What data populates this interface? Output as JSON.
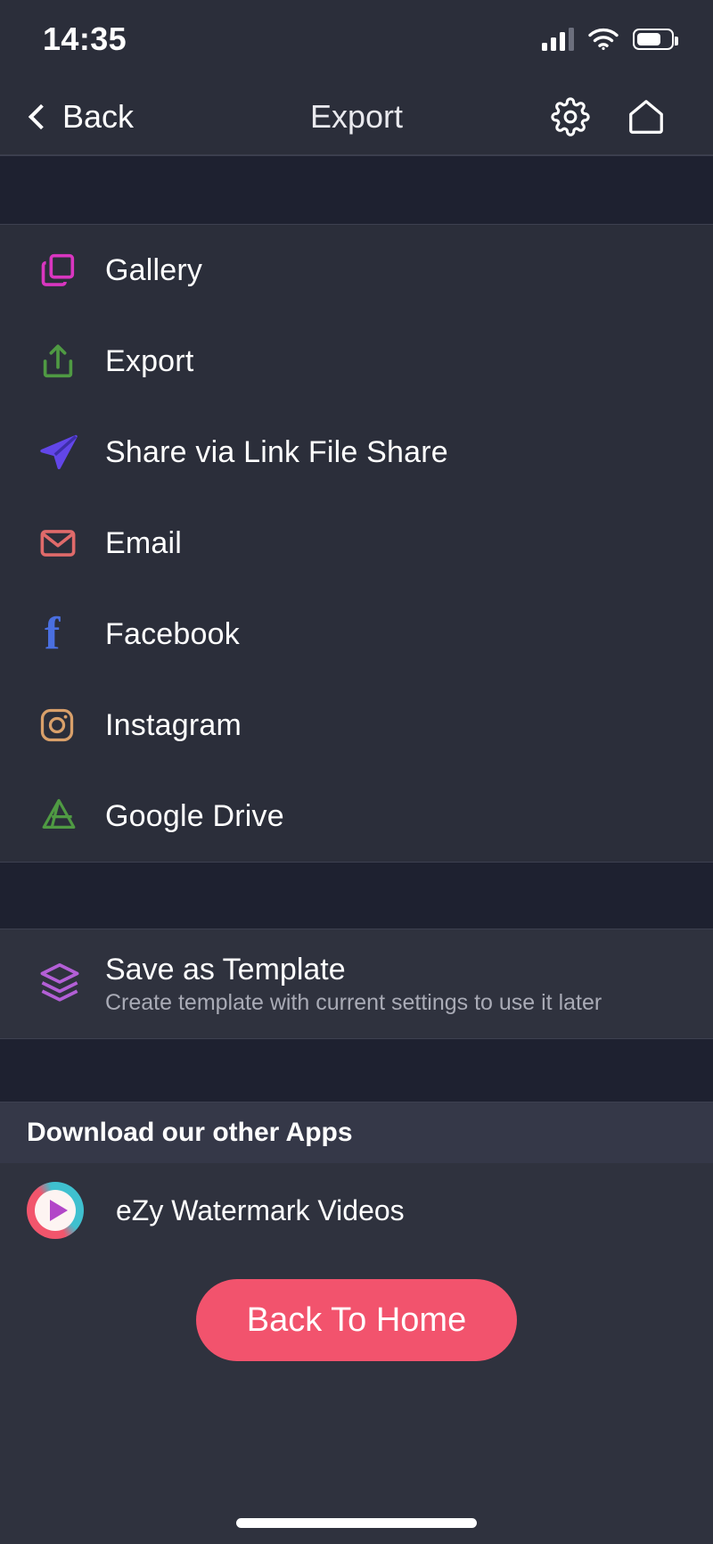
{
  "status_bar": {
    "time": "14:35",
    "signal_icon": "signal-bars-icon",
    "wifi_icon": "wifi-icon",
    "battery_icon": "battery-icon",
    "battery_level": 62
  },
  "nav": {
    "back_label": "Back",
    "title": "Export",
    "back_icon": "chevron-left-icon",
    "settings_icon": "gear-icon",
    "home_icon": "home-icon"
  },
  "export_options": [
    {
      "label": "Gallery",
      "icon": "gallery-copy-icon",
      "color": "#d936c0"
    },
    {
      "label": "Export",
      "icon": "export-upload-icon",
      "color": "#4f9a43"
    },
    {
      "label": "Share via Link File Share",
      "icon": "paper-plane-icon",
      "color": "#6246e8"
    },
    {
      "label": "Email",
      "icon": "envelope-icon",
      "color": "#e06a6a"
    },
    {
      "label": "Facebook",
      "icon": "facebook-icon",
      "color": "#4a6fe0"
    },
    {
      "label": "Instagram",
      "icon": "instagram-icon",
      "color": "#d9a06a"
    },
    {
      "label": "Google Drive",
      "icon": "google-drive-icon",
      "color": "#4f9a43"
    }
  ],
  "template": {
    "title": "Save as Template",
    "subtitle": "Create template with current settings to use it later",
    "icon": "layers-stack-icon",
    "color": "#b35fd6"
  },
  "download_apps": {
    "header": "Download our other Apps",
    "items": [
      {
        "name": "eZy Watermark Videos",
        "icon": "ezy-watermark-videos-icon"
      }
    ]
  },
  "cta": {
    "label": "Back To Home",
    "color": "#f2536d"
  }
}
